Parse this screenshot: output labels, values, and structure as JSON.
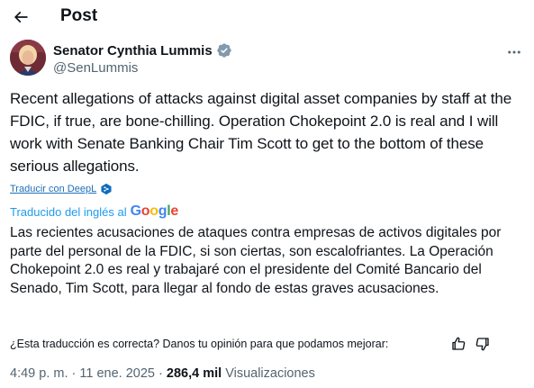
{
  "header": {
    "title": "Post",
    "back_icon": "arrow-left-icon"
  },
  "author": {
    "name": "Senator Cynthia Lummis",
    "handle": "@SenLummis",
    "verified_icon": "verified-badge-icon",
    "more_icon": "more-horizontal-icon"
  },
  "post": {
    "text": "Recent allegations of attacks against digital asset companies by staff at the FDIC, if true, are bone-chilling. Operation Chokepoint 2.0 is real and I will work with Senate Banking Chair Tim Scott to get to the bottom of these serious allegations."
  },
  "translation": {
    "deepl_link": "Traducir con DeepL",
    "translated_from": "Traducido del inglés al",
    "google_letters": [
      "G",
      "o",
      "o",
      "g",
      "l",
      "e"
    ],
    "body": "Las recientes acusaciones de ataques contra empresas de activos digitales por parte del personal de la FDIC, si son ciertas, son escalofriantes. La Operación Chokepoint 2.0 es real y trabajaré con el presidente del Comité Bancario del Senado, Tim Scott, para llegar al fondo de estas graves acusaciones.",
    "feedback_question": "¿Esta traducción es correcta? Danos tu opinión para que podamos mejorar:"
  },
  "meta": {
    "time": "4:49 p. m.",
    "separator1": "·",
    "date": "11 ene. 2025",
    "separator2": "·",
    "views_count": "286,4 mil",
    "views_label": "Visualizaciones"
  },
  "colors": {
    "accent": "#1d9bf0",
    "text": "#0f1419",
    "muted": "#536471"
  }
}
